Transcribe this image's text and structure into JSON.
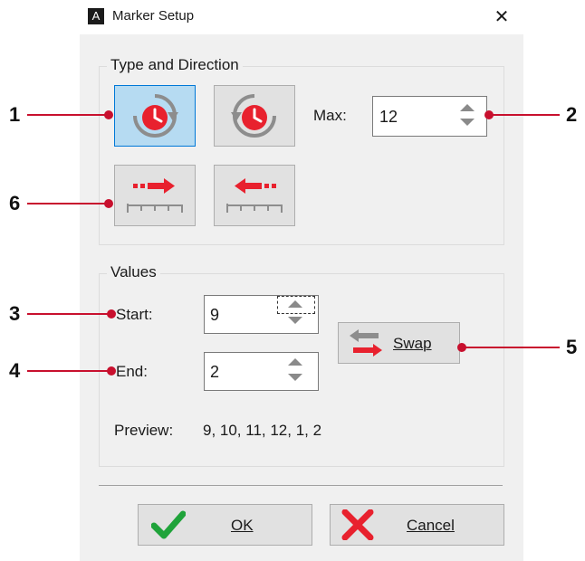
{
  "window": {
    "title": "Marker Setup",
    "app_icon_glyph": "A",
    "close_glyph": "✕"
  },
  "type_direction": {
    "label": "Type and Direction",
    "buttons": [
      {
        "icon": "clock-clockwise-icon",
        "active": true
      },
      {
        "icon": "clock-counterclockwise-icon",
        "active": false
      },
      {
        "icon": "ruler-arrow-right-icon",
        "active": false
      },
      {
        "icon": "ruler-arrow-left-icon",
        "active": false
      }
    ],
    "max_label": "Max:",
    "max_value": "12"
  },
  "values": {
    "label": "Values",
    "start_label": "Start:",
    "start_value": "9",
    "end_label": "End:",
    "end_value": "2",
    "swap_label": "Swap",
    "preview_label": "Preview:",
    "preview_value": "9, 10, 11, 12, 1, 2"
  },
  "actions": {
    "ok_label": "OK",
    "cancel_label": "Cancel"
  },
  "callouts": [
    "1",
    "2",
    "3",
    "4",
    "5",
    "6"
  ],
  "colors": {
    "accent_red": "#e8212e",
    "active_blue": "#b6dbf2",
    "active_border": "#0078d7",
    "ok_green": "#1fa33a"
  }
}
